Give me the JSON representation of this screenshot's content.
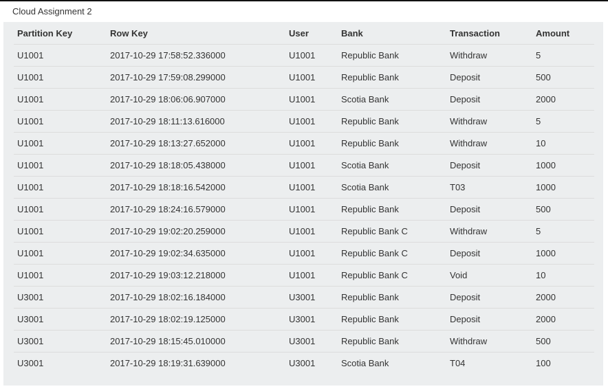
{
  "title": "Cloud Assignment 2",
  "table": {
    "columns": [
      "Partition Key",
      "Row Key",
      "User",
      "Bank",
      "Transaction",
      "Amount"
    ],
    "rows": [
      [
        "U1001",
        "2017-10-29 17:58:52.336000",
        "U1001",
        "Republic Bank",
        "Withdraw",
        "5"
      ],
      [
        "U1001",
        "2017-10-29 17:59:08.299000",
        "U1001",
        "Republic Bank",
        "Deposit",
        "500"
      ],
      [
        "U1001",
        "2017-10-29 18:06:06.907000",
        "U1001",
        "Scotia Bank",
        "Deposit",
        "2000"
      ],
      [
        "U1001",
        "2017-10-29 18:11:13.616000",
        "U1001",
        "Republic Bank",
        "Withdraw",
        "5"
      ],
      [
        "U1001",
        "2017-10-29 18:13:27.652000",
        "U1001",
        "Republic Bank",
        "Withdraw",
        "10"
      ],
      [
        "U1001",
        "2017-10-29 18:18:05.438000",
        "U1001",
        "Scotia Bank",
        "Deposit",
        "1000"
      ],
      [
        "U1001",
        "2017-10-29 18:18:16.542000",
        "U1001",
        "Scotia Bank",
        "T03",
        "1000"
      ],
      [
        "U1001",
        "2017-10-29 18:24:16.579000",
        "U1001",
        "Republic Bank",
        "Deposit",
        "500"
      ],
      [
        "U1001",
        "2017-10-29 19:02:20.259000",
        "U1001",
        "Republic Bank C",
        "Withdraw",
        "5"
      ],
      [
        "U1001",
        "2017-10-29 19:02:34.635000",
        "U1001",
        "Republic Bank C",
        "Deposit",
        "1000"
      ],
      [
        "U1001",
        "2017-10-29 19:03:12.218000",
        "U1001",
        "Republic Bank C",
        "Void",
        "10"
      ],
      [
        "U3001",
        "2017-10-29 18:02:16.184000",
        "U3001",
        "Republic Bank",
        "Deposit",
        "2000"
      ],
      [
        "U3001",
        "2017-10-29 18:02:19.125000",
        "U3001",
        "Republic Bank",
        "Deposit",
        "2000"
      ],
      [
        "U3001",
        "2017-10-29 18:15:45.010000",
        "U3001",
        "Republic Bank",
        "Withdraw",
        "500"
      ],
      [
        "U3001",
        "2017-10-29 18:19:31.639000",
        "U3001",
        "Scotia Bank",
        "T04",
        "100"
      ]
    ]
  },
  "colors": {
    "panel_background": "#eceeef",
    "row_divider": "#dcdcdc",
    "text": "#333333",
    "top_border": "#111111"
  }
}
